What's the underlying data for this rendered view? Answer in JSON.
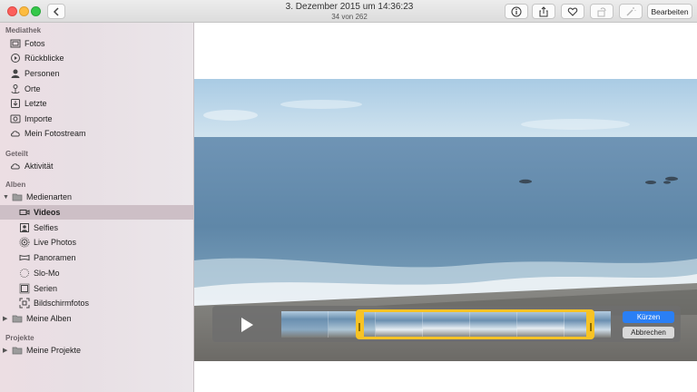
{
  "window": {
    "title": "3. Dezember 2015 um 14:36:23",
    "subtitle": "34 von 262",
    "edit_label": "Bearbeiten"
  },
  "toolbar": {
    "icons": [
      "info-icon",
      "share-icon",
      "heart-icon",
      "rotate-icon",
      "magic-wand-icon"
    ]
  },
  "sidebar": {
    "sections": {
      "library": "Mediathek",
      "shared": "Geteilt",
      "albums": "Alben",
      "projects": "Projekte"
    },
    "library_items": [
      {
        "label": "Fotos",
        "icon": "photos-icon"
      },
      {
        "label": "Rückblicke",
        "icon": "memories-icon"
      },
      {
        "label": "Personen",
        "icon": "person-icon"
      },
      {
        "label": "Orte",
        "icon": "pin-icon"
      },
      {
        "label": "Letzte",
        "icon": "import-icon"
      },
      {
        "label": "Importe",
        "icon": "camera-icon"
      },
      {
        "label": "Mein Fotostream",
        "icon": "cloud-icon"
      }
    ],
    "shared_items": [
      {
        "label": "Aktivität",
        "icon": "cloud-icon"
      }
    ],
    "album_groups": [
      {
        "label": "Medienarten",
        "expanded": true
      },
      {
        "label": "Meine Alben",
        "expanded": false
      }
    ],
    "media_types": [
      {
        "label": "Videos",
        "icon": "video-icon",
        "selected": true
      },
      {
        "label": "Selfies",
        "icon": "selfie-icon"
      },
      {
        "label": "Live Photos",
        "icon": "live-photo-icon"
      },
      {
        "label": "Panoramen",
        "icon": "panorama-icon"
      },
      {
        "label": "Slo-Mo",
        "icon": "slomo-icon"
      },
      {
        "label": "Serien",
        "icon": "burst-icon"
      },
      {
        "label": "Bildschirmfotos",
        "icon": "screenshot-icon"
      }
    ],
    "project_groups": [
      {
        "label": "Meine Projekte",
        "expanded": false
      }
    ]
  },
  "trim": {
    "confirm_label": "Kürzen",
    "cancel_label": "Abbrechen",
    "accent": "#f7c325",
    "confirm_color": "#2a7ff5"
  }
}
